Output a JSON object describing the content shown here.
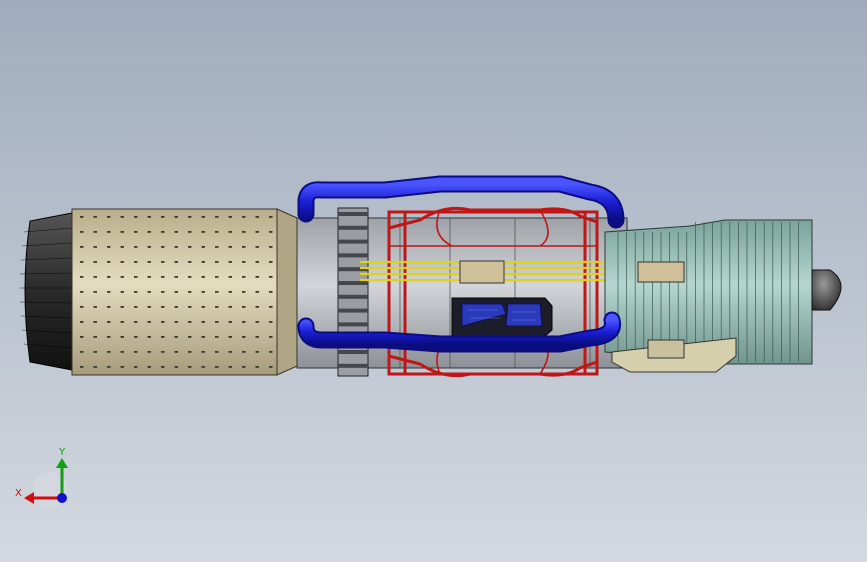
{
  "viewport": {
    "background_top": "#a0acbd",
    "background_bottom": "#d4d9e0"
  },
  "model": {
    "subject": "jet-engine-assembly",
    "colors": {
      "nozzle": "#2b2b2b",
      "afterburner": "#cfc6a6",
      "mid_casing": "#b9bcc1",
      "blue_pipes": "#1a1ed6",
      "red_frame": "#c01616",
      "yellow_lines": "#e0d21c",
      "fan_housing": "#8fb8b0",
      "spinner": "#555555",
      "mount_base": "#d6cfae"
    }
  },
  "triad": {
    "x_label": "X",
    "y_label": "Y",
    "x_color": "#d01010",
    "y_color": "#10a010",
    "z_color": "#1010d0"
  }
}
